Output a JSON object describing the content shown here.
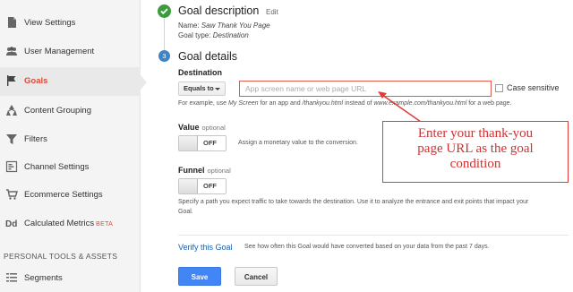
{
  "sidebar": {
    "items": [
      {
        "label": "View Settings",
        "icon": "document-icon"
      },
      {
        "label": "User Management",
        "icon": "users-icon"
      },
      {
        "label": "Goals",
        "icon": "flag-icon",
        "active": true
      },
      {
        "label": "Content Grouping",
        "icon": "content-grouping-icon"
      },
      {
        "label": "Filters",
        "icon": "filter-icon"
      },
      {
        "label": "Channel Settings",
        "icon": "channel-settings-icon"
      },
      {
        "label": "Ecommerce Settings",
        "icon": "cart-icon"
      },
      {
        "label": "Calculated Metrics",
        "icon": "dd-icon",
        "badge": "BETA"
      }
    ],
    "section_title": "PERSONAL TOOLS & ASSETS",
    "section_items": [
      {
        "label": "Segments",
        "icon": "segments-icon"
      }
    ]
  },
  "goal_description": {
    "title": "Goal description",
    "edit_label": "Edit",
    "name_prefix": "Name:",
    "name_value": "Saw Thank You Page",
    "type_prefix": "Goal type:",
    "type_value": "Destination"
  },
  "goal_details": {
    "step_number": "3",
    "title": "Goal details",
    "destination_label": "Destination",
    "match_type": "Equals to",
    "url_placeholder": "App screen name or web page URL",
    "case_sensitive_label": "Case sensitive",
    "help_part1": "For example, use",
    "help_em1": "My Screen",
    "help_part2": "for an app and",
    "help_em2": "/thankyou.html",
    "help_part3": "instead of",
    "help_em3": "www.example.com/thankyou.html",
    "help_part4": "for a web page.",
    "value_label": "Value",
    "value_optional": "optional",
    "value_toggle": "OFF",
    "value_help": "Assign a monetary value to the conversion.",
    "funnel_label": "Funnel",
    "funnel_optional": "optional",
    "funnel_toggle": "OFF",
    "funnel_help_line1": "Specify a path you expect traffic to take towards the destination. Use it to analyze the entrance and exit points that impact your",
    "funnel_help_line2": "Goal."
  },
  "verify": {
    "link": "Verify this Goal",
    "description": "See how often this Goal would have converted based on your data from the past 7 days."
  },
  "actions": {
    "save": "Save",
    "cancel": "Cancel"
  },
  "annotation": {
    "line1": "Enter your thank-you",
    "line2": "page URL as the goal",
    "line3": "condition"
  },
  "colors": {
    "accent_red": "#dd4b39",
    "check_green": "#3b9c3b",
    "step_blue": "#3d85c6",
    "save_blue": "#4285f4",
    "annotation_red": "#e53935"
  }
}
